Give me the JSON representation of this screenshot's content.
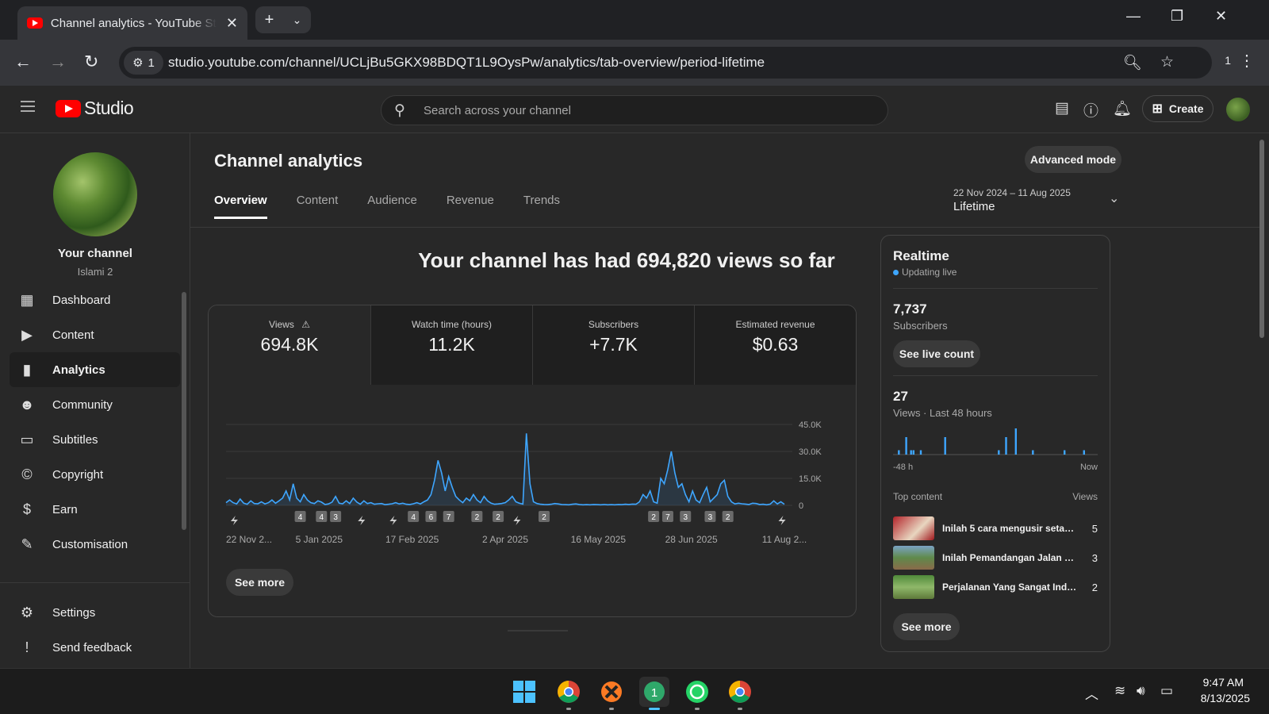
{
  "browser": {
    "tab_title": "Channel analytics - YouTube Studio",
    "url": "studio.youtube.com/channel/UCLjBu5GKX98BDQT1L9OysPw/analytics/tab-overview/period-lifetime",
    "site_info_count": "1",
    "extension_count": "1"
  },
  "header": {
    "logo_text": "Studio",
    "search_placeholder": "Search across your channel",
    "create_label": "Create"
  },
  "sidebar": {
    "channel_name": "Your channel",
    "channel_handle": "Islami 2",
    "items": [
      {
        "label": "Dashboard",
        "icon": "dashboard-icon"
      },
      {
        "label": "Content",
        "icon": "content-icon"
      },
      {
        "label": "Analytics",
        "icon": "analytics-icon"
      },
      {
        "label": "Community",
        "icon": "community-icon"
      },
      {
        "label": "Subtitles",
        "icon": "subtitles-icon"
      },
      {
        "label": "Copyright",
        "icon": "copyright-icon"
      },
      {
        "label": "Earn",
        "icon": "earn-icon"
      },
      {
        "label": "Customisation",
        "icon": "customisation-icon"
      }
    ],
    "footer_items": [
      {
        "label": "Settings",
        "icon": "settings-icon"
      },
      {
        "label": "Send feedback",
        "icon": "feedback-icon"
      }
    ]
  },
  "main": {
    "title": "Channel analytics",
    "advanced_mode": "Advanced mode",
    "tabs": [
      "Overview",
      "Content",
      "Audience",
      "Revenue",
      "Trends"
    ],
    "period_range": "22 Nov 2024 – 11 Aug 2025",
    "period_label": "Lifetime",
    "headline": "Your channel has had 694,820 views so far",
    "metrics": [
      {
        "label": "Views",
        "value": "694.8K"
      },
      {
        "label": "Watch time (hours)",
        "value": "11.2K"
      },
      {
        "label": "Subscribers",
        "value": "+7.7K"
      },
      {
        "label": "Estimated revenue",
        "value": "$0.63"
      }
    ],
    "see_more": "See more"
  },
  "chart_data": {
    "type": "line",
    "series": [
      {
        "values": [
          1500,
          3000,
          1500,
          800,
          3500,
          1200,
          600,
          2500,
          1000,
          900,
          2000,
          800,
          1500,
          3000,
          1200,
          2500,
          4000,
          8000,
          3000,
          12000,
          4000,
          2000,
          6000,
          3000,
          1500,
          1000,
          2500,
          1800,
          500,
          800,
          1800,
          5000,
          1200,
          900,
          2500,
          1000,
          4000,
          1800,
          600,
          2500,
          1000,
          1500,
          600,
          900,
          1000,
          400,
          600,
          900,
          1500,
          800,
          1200,
          600,
          500,
          900,
          1500,
          800,
          2000,
          3000,
          6000,
          14000,
          25000,
          18000,
          8000,
          16000,
          10000,
          5000,
          3000,
          1500,
          4000,
          2500,
          6000,
          3000,
          1500,
          5000,
          2500,
          1200,
          600,
          800,
          1000,
          1500,
          3000,
          5000,
          2000,
          1200,
          700,
          40000,
          12000,
          2000,
          1000,
          600,
          500,
          400,
          600,
          1000,
          800,
          500,
          400,
          300,
          600,
          800,
          500,
          300,
          400,
          300,
          500,
          400,
          300,
          500,
          300,
          400,
          300,
          500,
          400,
          600,
          500,
          700,
          600,
          2000,
          6000,
          4000,
          8000,
          2000,
          1200,
          15000,
          12000,
          20000,
          30000,
          18000,
          10000,
          12000,
          6000,
          2000,
          8000,
          3000,
          1500,
          6000,
          10000,
          2000,
          4000,
          6000,
          12000,
          14000,
          5000,
          2000,
          800,
          1200,
          900,
          700,
          500,
          1200,
          1000,
          500,
          600,
          300,
          700,
          2500,
          800,
          2000,
          600
        ]
      }
    ],
    "x_tick_labels": [
      "22 Nov 2...",
      "5 Jan 2025",
      "17 Feb 2025",
      "2 Apr 2025",
      "16 May 2025",
      "28 Jun 2025",
      "11 Aug 2..."
    ],
    "y_tick_labels": [
      "45.0K",
      "30.0K",
      "15.0K",
      "0"
    ],
    "ylim": [
      0,
      45000
    ],
    "grid": true,
    "annotations": [
      {
        "x_index": 2,
        "label": "short"
      },
      {
        "x_index": 21,
        "label": "4"
      },
      {
        "x_index": 27,
        "label": "4"
      },
      {
        "x_index": 31,
        "label": "3"
      },
      {
        "x_index": 38,
        "label": "short"
      },
      {
        "x_index": 47,
        "label": "short"
      },
      {
        "x_index": 53,
        "label": "4"
      },
      {
        "x_index": 58,
        "label": "6"
      },
      {
        "x_index": 63,
        "label": "7"
      },
      {
        "x_index": 71,
        "label": "2"
      },
      {
        "x_index": 77,
        "label": "2"
      },
      {
        "x_index": 82,
        "label": "short"
      },
      {
        "x_index": 90,
        "label": "2"
      },
      {
        "x_index": 121,
        "label": "2"
      },
      {
        "x_index": 125,
        "label": "7"
      },
      {
        "x_index": 130,
        "label": "3"
      },
      {
        "x_index": 137,
        "label": "3"
      },
      {
        "x_index": 142,
        "label": "2"
      },
      {
        "x_index": 157,
        "label": "short"
      }
    ]
  },
  "realtime": {
    "title": "Realtime",
    "status": "Updating live",
    "subscribers_value": "7,737",
    "subscribers_label": "Subscribers",
    "see_live_count": "See live count",
    "views_value": "27",
    "views_label": "Views · Last 48 hours",
    "axis_start": "-48 h",
    "axis_end": "Now",
    "top_content_label": "Top content",
    "views_col": "Views",
    "top_content": [
      {
        "title": "Inilah 5 cara mengusir setan ...",
        "views": "5"
      },
      {
        "title": "Inilah Pemandangan Jalan Di ...",
        "views": "3"
      },
      {
        "title": "Perjalanan Yang Sangat Inda...",
        "views": "2"
      }
    ],
    "see_more": "See more",
    "bars": [
      0,
      0,
      1,
      0,
      0,
      4,
      0,
      1,
      1,
      0,
      0,
      1,
      0,
      0,
      0,
      0,
      0,
      0,
      0,
      0,
      0,
      4,
      0,
      0,
      0,
      0,
      0,
      0,
      0,
      0,
      0,
      0,
      0,
      0,
      0,
      0,
      0,
      0,
      0,
      0,
      0,
      0,
      0,
      1,
      0,
      0,
      4,
      0,
      0,
      0,
      6,
      0,
      0,
      0,
      0,
      0,
      0,
      1,
      0,
      0,
      0,
      0,
      0,
      0,
      0,
      0,
      0,
      0,
      0,
      0,
      1,
      0,
      0,
      0,
      0,
      0,
      0,
      0,
      1,
      0,
      0,
      0,
      0,
      0
    ]
  },
  "taskbar": {
    "time": "9:47 AM",
    "date": "8/13/2025"
  }
}
